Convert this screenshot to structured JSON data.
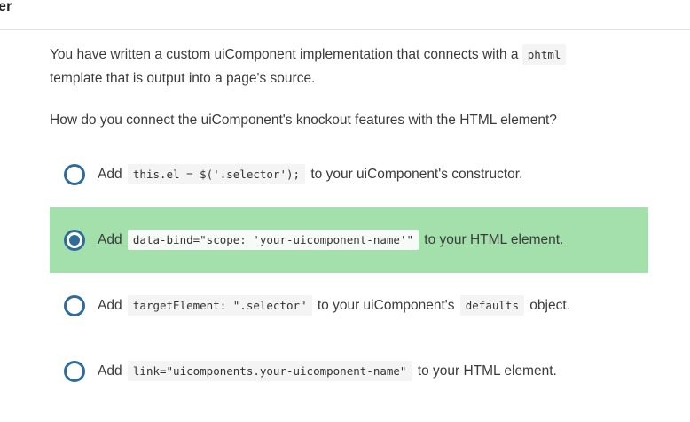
{
  "header": {
    "title_fragment": "er"
  },
  "question": {
    "intro_before": "You have written a custom uiComponent implementation that connects with a ",
    "intro_code": "phtml",
    "intro_after": "template that is output into a page's source.",
    "prompt": "How do you connect the uiComponent's knockout features with the HTML element?"
  },
  "options": [
    {
      "prefix": "Add ",
      "code": "this.el = $('.selector');",
      "middle": " to your uiComponent's constructor.",
      "code2": "",
      "suffix": "",
      "selected": false
    },
    {
      "prefix": "Add ",
      "code": "data-bind=\"scope: 'your-uicomponent-name'\"",
      "middle": " to your HTML element.",
      "code2": "",
      "suffix": "",
      "selected": true
    },
    {
      "prefix": "Add ",
      "code": "targetElement: \".selector\"",
      "middle": " to your uiComponent's ",
      "code2": "defaults",
      "suffix": " object.",
      "selected": false
    },
    {
      "prefix": "Add ",
      "code": "link=\"uicomponents.your-uicomponent-name\"",
      "middle": " to your HTML element.",
      "code2": "",
      "suffix": "",
      "selected": false
    }
  ],
  "colors": {
    "selected_background": "#a3e0ab",
    "radio_accent": "#2f6c9a",
    "code_background": "#f4f4f4"
  }
}
